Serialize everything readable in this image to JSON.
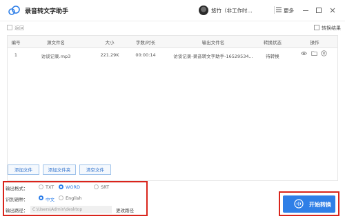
{
  "app": {
    "title": "录音转文字助手"
  },
  "user": {
    "name": "悠竹（非工作时..."
  },
  "header": {
    "more_label": "更多"
  },
  "toolbar": {
    "back_label": "返回",
    "result_label": "转换结果"
  },
  "table": {
    "columns": [
      "编号",
      "源文件名",
      "大小",
      "字数/时长",
      "输出文件名",
      "转换状态",
      "操作"
    ],
    "rows": [
      {
        "index": "1",
        "source": "访谈记录.mp3",
        "size": "221.29K",
        "duration": "00:00:14",
        "output": "访谈记录-录音转文字助手-16529534...",
        "status": "待转换"
      }
    ],
    "row_actions": [
      "eye-icon",
      "folder-icon",
      "close-circle-icon"
    ]
  },
  "buttons": {
    "add_file": "添加文件",
    "add_folder": "添加文件夹",
    "clear": "清空文件"
  },
  "settings": {
    "format_label": "输出格式：",
    "format_options": [
      "TXT",
      "WORD",
      "SRT"
    ],
    "format_selected": "WORD",
    "lang_label": "识别语种：",
    "lang_options": [
      "中文",
      "English"
    ],
    "lang_selected": "中文",
    "path_label": "输出路径：",
    "path_value": "C:\\Users\\Admin\\desktop",
    "change_path": "更改路径"
  },
  "start": {
    "label": "开始转换"
  },
  "colors": {
    "accent": "#2f7fe7",
    "highlight": "#d9241b"
  }
}
